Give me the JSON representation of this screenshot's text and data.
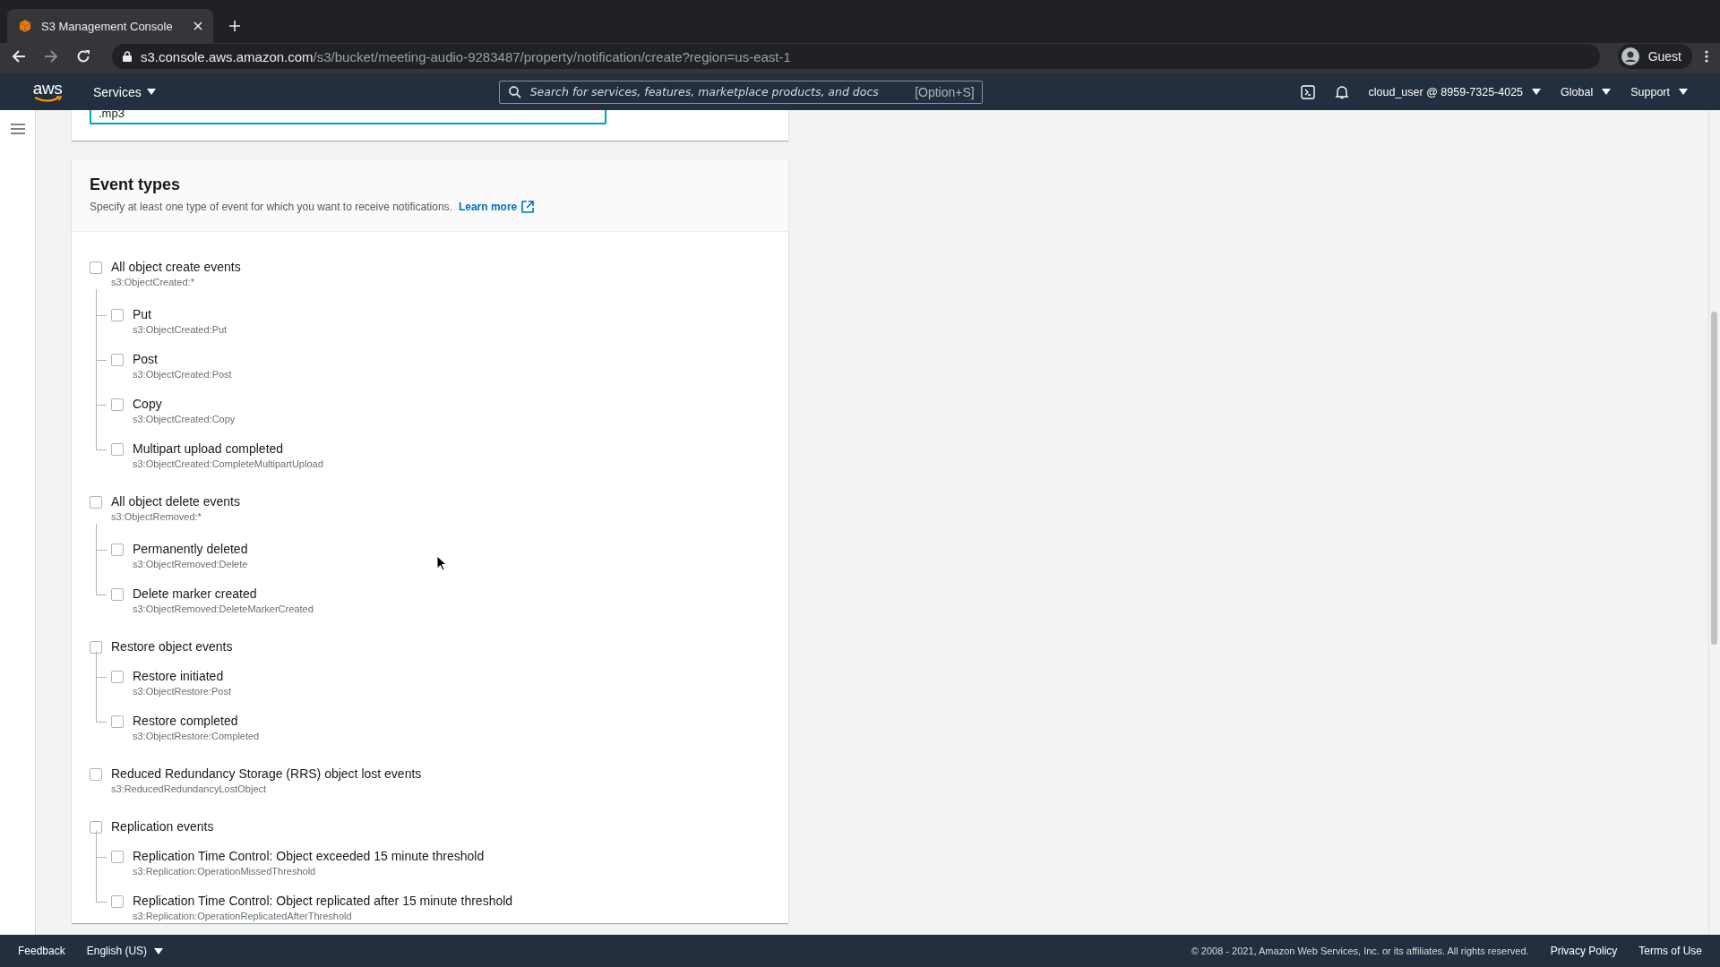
{
  "browser": {
    "tab_title": "S3 Management Console",
    "url_host": "s3.console.aws.amazon.com",
    "url_path": "/s3/bucket/meeting-audio-9283487/property/notification/create?region=us-east-1",
    "profile": "Guest"
  },
  "nav": {
    "logo_text": "aws",
    "services": "Services",
    "search_placeholder": "Search for services, features, marketplace products, and docs",
    "search_shortcut": "[Option+S]",
    "account": "cloud_user @ 8959-7325-4025",
    "region": "Global",
    "support": "Support"
  },
  "suffix_field": {
    "value": ".mp3"
  },
  "event_types": {
    "title": "Event types",
    "description": "Specify at least one type of event for which you want to receive notifications.",
    "learn_more": "Learn more",
    "groups": [
      {
        "label": "All object create events",
        "code": "s3:ObjectCreated:*",
        "checked": false,
        "children": [
          {
            "label": "Put",
            "code": "s3:ObjectCreated:Put",
            "checked": false
          },
          {
            "label": "Post",
            "code": "s3:ObjectCreated:Post",
            "checked": false
          },
          {
            "label": "Copy",
            "code": "s3:ObjectCreated:Copy",
            "checked": false
          },
          {
            "label": "Multipart upload completed",
            "code": "s3:ObjectCreated:CompleteMultipartUpload",
            "checked": false
          }
        ]
      },
      {
        "label": "All object delete events",
        "code": "s3:ObjectRemoved:*",
        "checked": false,
        "children": [
          {
            "label": "Permanently deleted",
            "code": "s3:ObjectRemoved:Delete",
            "checked": false
          },
          {
            "label": "Delete marker created",
            "code": "s3:ObjectRemoved:DeleteMarkerCreated",
            "checked": false
          }
        ]
      },
      {
        "label": "Restore object events",
        "checked": false,
        "children": [
          {
            "label": "Restore initiated",
            "code": "s3:ObjectRestore:Post",
            "checked": false
          },
          {
            "label": "Restore completed",
            "code": "s3:ObjectRestore:Completed",
            "checked": false
          }
        ]
      },
      {
        "label": "Reduced Redundancy Storage (RRS) object lost events",
        "code": "s3:ReducedRedundancyLostObject",
        "checked": false
      },
      {
        "label": "Replication events",
        "checked": false,
        "children": [
          {
            "label": "Replication Time Control: Object exceeded 15 minute threshold",
            "code": "s3:Replication:OperationMissedThreshold",
            "checked": false
          },
          {
            "label": "Replication Time Control: Object replicated after 15 minute threshold",
            "code": "s3:Replication:OperationReplicatedAfterThreshold",
            "checked": false
          }
        ]
      }
    ]
  },
  "footer": {
    "feedback": "Feedback",
    "language": "English (US)",
    "copyright": "© 2008 - 2021, Amazon Web Services, Inc. or its affiliates. All rights reserved.",
    "privacy": "Privacy Policy",
    "terms": "Terms of Use"
  }
}
